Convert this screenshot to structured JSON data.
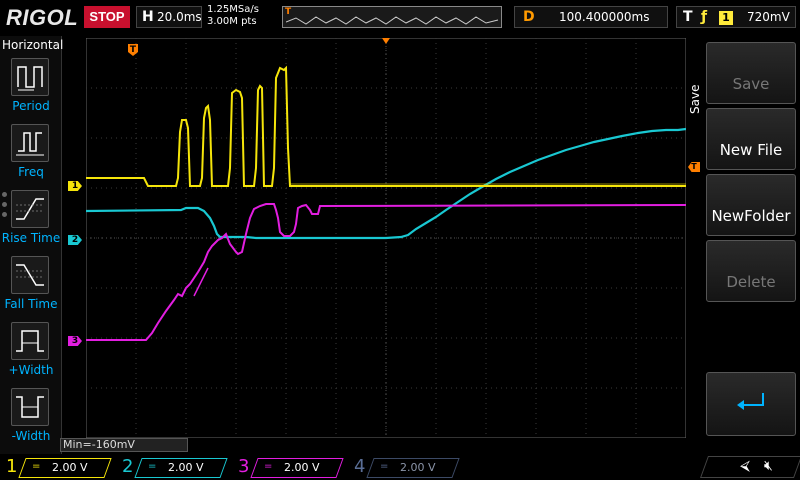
{
  "top": {
    "brand": "RIGOL",
    "run_state": "STOP",
    "timebase_label": "H",
    "timebase_value": "20.0ms",
    "sample_rate": "1.25MSa/s",
    "memory_depth": "3.00M pts",
    "mem_trigger_marker": "T",
    "delay_label": "D",
    "delay_value": "100.400000ms",
    "trigger_label": "T",
    "trigger_edge": "ƒ",
    "trigger_source": "1",
    "trigger_level": "720mV"
  },
  "left_menu": {
    "title": "Horizontal",
    "items": [
      {
        "label": "Period",
        "icon": "period-icon"
      },
      {
        "label": "Freq",
        "icon": "freq-icon"
      },
      {
        "label": "Rise Time",
        "icon": "rise-time-icon"
      },
      {
        "label": "Fall Time",
        "icon": "fall-time-icon"
      },
      {
        "label": "+Width",
        "icon": "positive-width-icon"
      },
      {
        "label": "-Width",
        "icon": "negative-width-icon"
      }
    ]
  },
  "grid": {
    "trigger_pos_marker": "T",
    "trigger_level_marker": "T",
    "channel_markers": [
      "1",
      "2",
      "3"
    ],
    "min_readout": "Min=-160mV"
  },
  "right_menu": {
    "title": "Save",
    "buttons": [
      {
        "label": "Save",
        "enabled": false
      },
      {
        "label": "New File",
        "enabled": true
      },
      {
        "label": "NewFolder",
        "enabled": true
      },
      {
        "label": "Delete",
        "enabled": false
      }
    ],
    "back_icon": "return-arrow-icon"
  },
  "channels": [
    {
      "num": "1",
      "scale": "2.00 V",
      "coupling": "=",
      "color": "#f5e50a",
      "active": true
    },
    {
      "num": "2",
      "scale": "2.00 V",
      "coupling": "=",
      "color": "#19c8d2",
      "active": true
    },
    {
      "num": "3",
      "scale": "2.00 V",
      "coupling": "=",
      "color": "#e21ee0",
      "active": true
    },
    {
      "num": "4",
      "scale": "2.00 V",
      "coupling": "=",
      "color": "#5a6e96",
      "active": false
    }
  ],
  "status_icons": [
    "usb-icon",
    "speaker-muted-icon"
  ],
  "colors": {
    "ch1": "#f5e50a",
    "ch2": "#19c8d2",
    "ch3": "#e21ee0",
    "trigger": "#ff7f00",
    "stop": "#c8102e",
    "menu_label": "#00b4ff"
  }
}
